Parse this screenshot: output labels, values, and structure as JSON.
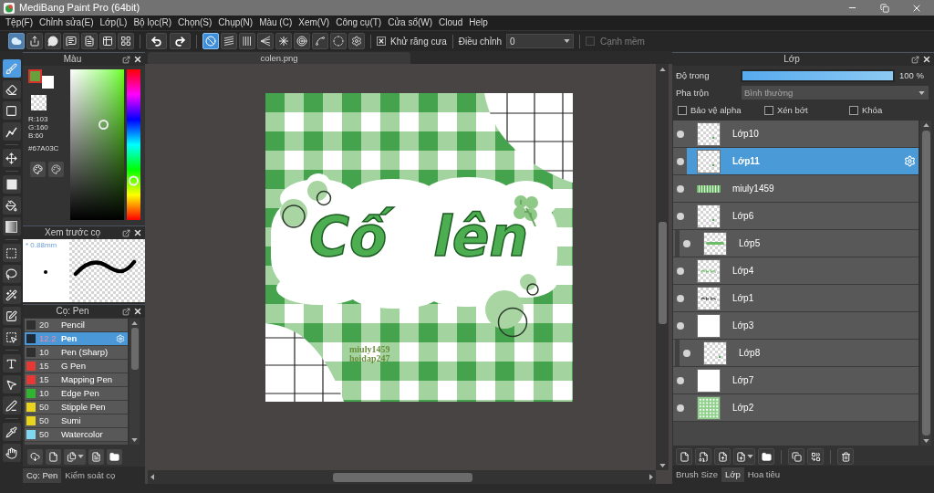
{
  "window": {
    "title": "MediBang Paint Pro (64bit)"
  },
  "menu": [
    "Tệp(F)",
    "Chỉnh sửa(E)",
    "Lớp(L)",
    "Bộ lọc(R)",
    "Chọn(S)",
    "Chụp(N)",
    "Màu (C)",
    "Xem(V)",
    "Công cụ(T)",
    "Cửa sổ(W)",
    "Cloud",
    "Help"
  ],
  "toolbar": {
    "snap_buttons": [
      {
        "selected": true
      },
      {
        "selected": false
      },
      {
        "selected": false
      },
      {
        "selected": false
      },
      {
        "selected": false
      },
      {
        "selected": false
      },
      {
        "selected": false
      },
      {
        "selected": false
      },
      {
        "selected": false
      }
    ],
    "antialias": {
      "label": "Khử răng cưa",
      "checked": true
    },
    "adjust": {
      "label": "Điều chỉnh",
      "value": "0"
    },
    "soft_edge": {
      "label": "Cạnh mềm",
      "checked": false,
      "disabled": true
    }
  },
  "tools": [
    {
      "selected": true
    },
    {
      "selected": false
    },
    {
      "selected": false
    },
    {
      "selected": false
    },
    {
      "selected": false
    },
    {
      "selected": false
    },
    {
      "selected": false
    },
    {
      "selected": false
    },
    {
      "selected": false
    },
    {
      "selected": false
    },
    {
      "selected": false
    },
    {
      "selected": false
    },
    {
      "selected": false
    },
    {
      "selected": false
    },
    {
      "selected": false
    },
    {
      "selected": false
    },
    {
      "selected": false
    },
    {
      "selected": false
    }
  ],
  "color_panel": {
    "title": "Màu",
    "foreground": {
      "color": "#67a03c"
    },
    "background": {
      "color": "#ffffff"
    },
    "rgb": [
      "R:103",
      "G:160",
      "B:60"
    ],
    "hex": "#67A03C",
    "hue_slider": {
      "level": 0.26
    }
  },
  "brush_preview": {
    "title": "Xem trước cọ",
    "size": "* 0.88mm"
  },
  "brush_panel": {
    "title": "Cọ: Pen",
    "brushes": [
      {
        "size": "20",
        "name": "Pencil",
        "color": "#2f2f2f",
        "selected": false
      },
      {
        "size": "12.2",
        "name": "Pen",
        "color": "#1f2a36",
        "selected": true
      },
      {
        "size": "10",
        "name": "Pen (Sharp)",
        "color": "#2f2f2f",
        "selected": false
      },
      {
        "size": "15",
        "name": "G Pen",
        "color": "#e53935",
        "selected": false
      },
      {
        "size": "15",
        "name": "Mapping Pen",
        "color": "#e53935",
        "selected": false
      },
      {
        "size": "10",
        "name": "Edge Pen",
        "color": "#2fb52f",
        "selected": false
      },
      {
        "size": "50",
        "name": "Stipple Pen",
        "color": "#e8d41c",
        "selected": false
      },
      {
        "size": "50",
        "name": "Sumi",
        "color": "#e8d41c",
        "selected": false
      },
      {
        "size": "50",
        "name": "Watercolor",
        "color": "#7fd8f0",
        "selected": false
      }
    ]
  },
  "left_tabs": [
    {
      "label": "Cọ: Pen",
      "selected": true
    },
    {
      "label": "Kiểm soát cọ",
      "selected": false
    }
  ],
  "document": {
    "tab": "colen.png",
    "artwork": {
      "title": "Cố lên",
      "signature": [
        "miuly1459",
        "hoidap247"
      ]
    }
  },
  "layer_panel": {
    "title": "Lớp",
    "opacity": {
      "label": "Độ trong",
      "level": 1,
      "reading": "100 %"
    },
    "blend": {
      "label": "Pha trộn",
      "value": "Bình thường"
    },
    "options": [
      {
        "label": "Bảo vệ alpha",
        "checked": false
      },
      {
        "label": "Xén bớt",
        "checked": false
      },
      {
        "label": "Khóa",
        "checked": false
      }
    ],
    "layers": [
      {
        "name": "Lớp10",
        "visible": true,
        "selected": false,
        "clipping": false,
        "thumbnail": {
          "kind": "checker"
        }
      },
      {
        "name": "Lớp11",
        "visible": true,
        "selected": true,
        "clipping": false,
        "thumbnail": {
          "kind": "checker"
        }
      },
      {
        "name": "miuly1459",
        "visible": true,
        "selected": false,
        "clipping": false,
        "thumbnail": {
          "kind": "strip"
        }
      },
      {
        "name": "Lớp6",
        "visible": true,
        "selected": false,
        "clipping": false,
        "thumbnail": {
          "kind": "checker"
        }
      },
      {
        "name": "Lớp5",
        "visible": true,
        "selected": false,
        "clipping": true,
        "thumbnail": {
          "kind": "stroke"
        }
      },
      {
        "name": "Lớp4",
        "visible": true,
        "selected": false,
        "clipping": false,
        "thumbnail": {
          "kind": "green_text"
        }
      },
      {
        "name": "Lớp1",
        "visible": true,
        "selected": false,
        "clipping": false,
        "thumbnail": {
          "kind": "dark_text"
        }
      },
      {
        "name": "Lớp3",
        "visible": true,
        "selected": false,
        "clipping": false,
        "thumbnail": {
          "kind": "white"
        }
      },
      {
        "name": "Lớp8",
        "visible": true,
        "selected": false,
        "clipping": true,
        "thumbnail": {
          "kind": "checker"
        }
      },
      {
        "name": "Lớp7",
        "visible": true,
        "selected": false,
        "clipping": false,
        "thumbnail": {
          "kind": "white"
        }
      },
      {
        "name": "Lớp2",
        "visible": true,
        "selected": false,
        "clipping": false,
        "thumbnail": {
          "kind": "gingham"
        }
      }
    ]
  },
  "right_tabs": [
    {
      "label": "Brush Size",
      "selected": false
    },
    {
      "label": "Lớp",
      "selected": true
    },
    {
      "label": "Hoa tiêu",
      "selected": false
    }
  ]
}
